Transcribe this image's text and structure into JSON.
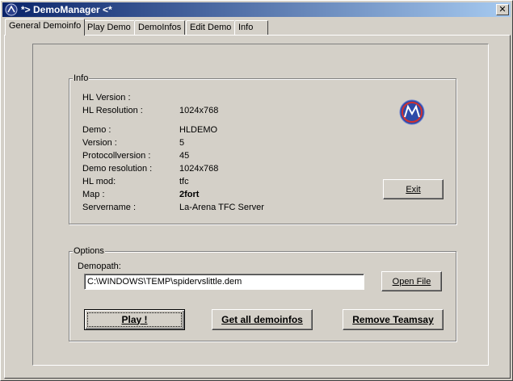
{
  "window": {
    "title": "*> DemoManager <*",
    "close_label": "✕"
  },
  "tabs": [
    {
      "label": "General Demoinfo",
      "active": true
    },
    {
      "label": "Play Demo",
      "active": false
    },
    {
      "label": "DemoInfos",
      "active": false
    },
    {
      "label": "Edit Demo",
      "active": false
    },
    {
      "label": "Info",
      "active": false
    }
  ],
  "info": {
    "group_label": "Info",
    "hl_version_label": "HL Version :",
    "hl_version_value": "",
    "hl_resolution_label": "HL Resolution :",
    "hl_resolution_value": "1024x768",
    "demo_label": "Demo :",
    "demo_value": "HLDEMO",
    "version_label": "Version :",
    "version_value": "5",
    "protocol_label": "Protocollversion :",
    "protocol_value": "45",
    "demo_res_label": "Demo resolution :",
    "demo_res_value": "1024x768",
    "hl_mod_label": "HL mod:",
    "hl_mod_value": "tfc",
    "map_label": "Map :",
    "map_value": "2fort",
    "servername_label": "Servername :",
    "servername_value": "La-Arena TFC Server",
    "exit_label": "Exit",
    "logo_icon": "demomanager-logo-icon"
  },
  "options": {
    "group_label": "Options",
    "demopath_label": "Demopath:",
    "demopath_value": "C:\\WINDOWS\\TEMP\\spidervslittle.dem",
    "open_file_label": "Open File",
    "play_label": "Play !",
    "get_all_label": "Get all demoinfos",
    "remove_teamsay_label": "Remove Teamsay"
  }
}
